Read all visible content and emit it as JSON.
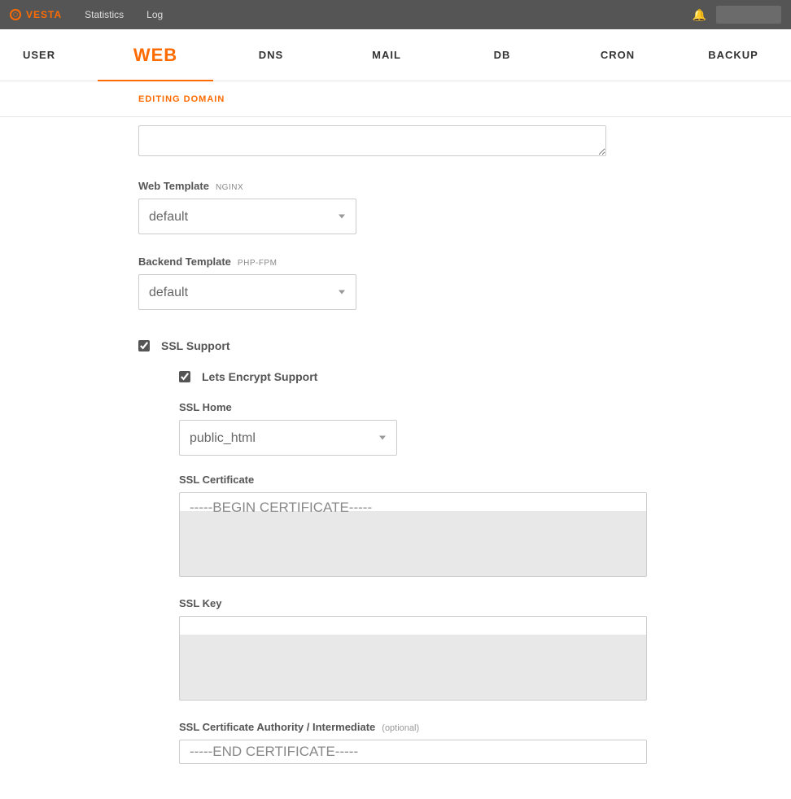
{
  "topbar": {
    "brand": "VESTA",
    "links": {
      "stats": "Statistics",
      "log": "Log"
    }
  },
  "nav": {
    "user": "USER",
    "web": "WEB",
    "dns": "DNS",
    "mail": "MAIL",
    "db": "DB",
    "cron": "CRON",
    "backup": "BACKUP"
  },
  "subheader": {
    "title": "EDITING DOMAIN"
  },
  "form": {
    "web_template": {
      "label": "Web Template",
      "engine": "NGINX",
      "value": "default"
    },
    "backend_template": {
      "label": "Backend Template",
      "engine": "PHP-FPM",
      "value": "default"
    },
    "ssl_support": {
      "label": "SSL Support",
      "checked": true
    },
    "lets_encrypt": {
      "label": "Lets Encrypt Support",
      "checked": true
    },
    "ssl_home": {
      "label": "SSL Home",
      "value": "public_html"
    },
    "ssl_cert": {
      "label": "SSL Certificate",
      "value": "-----BEGIN CERTIFICATE-----"
    },
    "ssl_key": {
      "label": "SSL Key",
      "value": ""
    },
    "ssl_ca": {
      "label": "SSL Certificate Authority / Intermediate",
      "optional": "(optional)",
      "value": "-----END CERTIFICATE-----"
    }
  }
}
